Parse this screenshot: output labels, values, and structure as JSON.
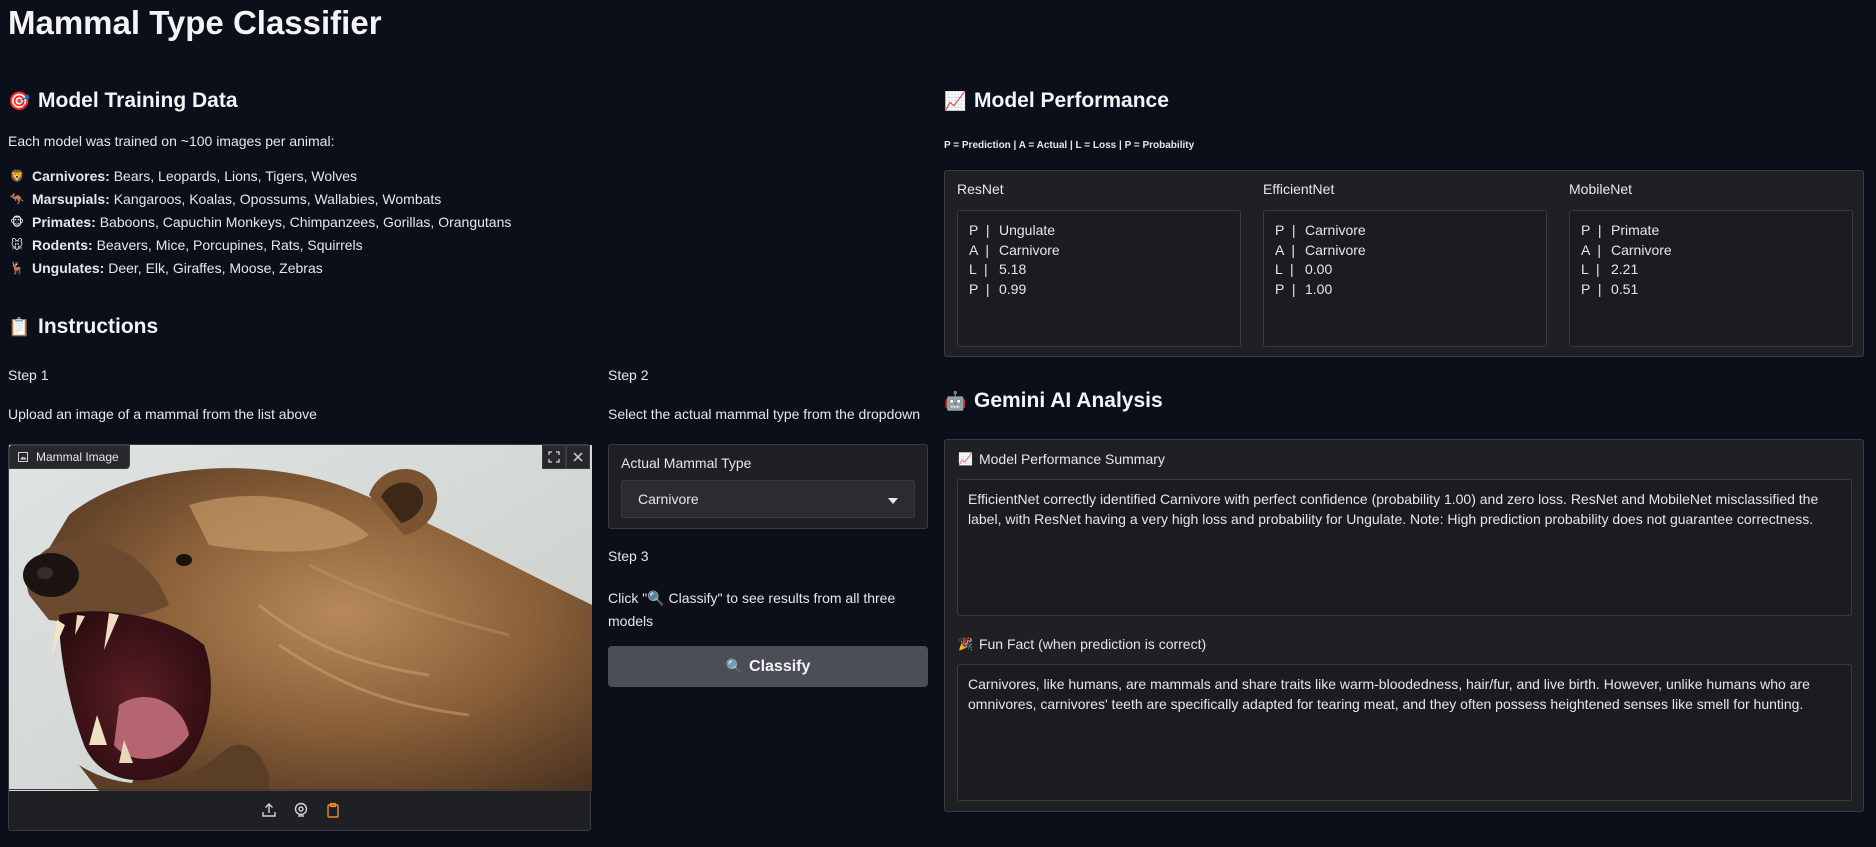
{
  "app": {
    "title": "Mammal Type Classifier"
  },
  "training": {
    "heading_emoji": "🎯",
    "heading": "Model Training Data",
    "intro": "Each model was trained on ~100 images per animal:",
    "groups": [
      {
        "emoji": "🦁",
        "name": "Carnivores:",
        "animals": "Bears, Leopards, Lions, Tigers, Wolves"
      },
      {
        "emoji": "🦘",
        "name": "Marsupials:",
        "animals": "Kangaroos, Koalas, Opossums, Wallabies, Wombats"
      },
      {
        "emoji": "🐵",
        "name": "Primates:",
        "animals": "Baboons, Capuchin Monkeys, Chimpanzees, Gorillas, Orangutans"
      },
      {
        "emoji": "🐭",
        "name": "Rodents:",
        "animals": "Beavers, Mice, Porcupines, Rats, Squirrels"
      },
      {
        "emoji": "🦌",
        "name": "Ungulates:",
        "animals": "Deer, Elk, Giraffes, Moose, Zebras"
      }
    ]
  },
  "instructions": {
    "heading_emoji": "📋",
    "heading": "Instructions",
    "step1_label": "Step 1",
    "step1_text": "Upload an image of a mammal from the list above",
    "step2_label": "Step 2",
    "step2_text": "Select the actual mammal type from the dropdown",
    "step3_label": "Step 3",
    "step3_text": "Click \"🔍 Classify\" to see results from all three models"
  },
  "image_input": {
    "label": "Mammal Image",
    "toolbar_icons": [
      "upload-icon",
      "webcam-icon",
      "clipboard-icon"
    ]
  },
  "actual_type": {
    "label": "Actual Mammal Type",
    "selected": "Carnivore"
  },
  "classify_button": {
    "icon": "🔍",
    "label": "Classify"
  },
  "performance": {
    "heading_emoji": "📈",
    "heading": "Model Performance",
    "legend": "P = Prediction | A = Actual | L = Loss | P = Probability",
    "models": [
      {
        "name": "ResNet",
        "prediction": "Ungulate",
        "actual": "Carnivore",
        "loss": "5.18",
        "probability": "0.99"
      },
      {
        "name": "EfficientNet",
        "prediction": "Carnivore",
        "actual": "Carnivore",
        "loss": "0.00",
        "probability": "1.00"
      },
      {
        "name": "MobileNet",
        "prediction": "Primate",
        "actual": "Carnivore",
        "loss": "2.21",
        "probability": "0.51"
      }
    ],
    "keys": {
      "p": "P  |",
      "a": "A  |",
      "l": "L  |"
    }
  },
  "gemini": {
    "heading_emoji": "🤖",
    "heading": "Gemini AI Analysis",
    "summary_emoji": "📈",
    "summary_label": "Model Performance Summary",
    "summary_text": "EfficientNet correctly identified Carnivore with perfect confidence (probability 1.00) and zero loss. ResNet and MobileNet misclassified the label, with ResNet having a very high loss and probability for Ungulate. Note: High prediction probability does not guarantee correctness.",
    "fact_emoji": "🎉",
    "fact_label": "Fun Fact (when prediction is correct)",
    "fact_text": "Carnivores, like humans, are mammals and share traits like warm-bloodedness, hair/fur, and live birth. However, unlike humans who are omnivores, carnivores' teeth are specifically adapted for tearing meat, and they often possess heightened senses like smell for hunting."
  }
}
